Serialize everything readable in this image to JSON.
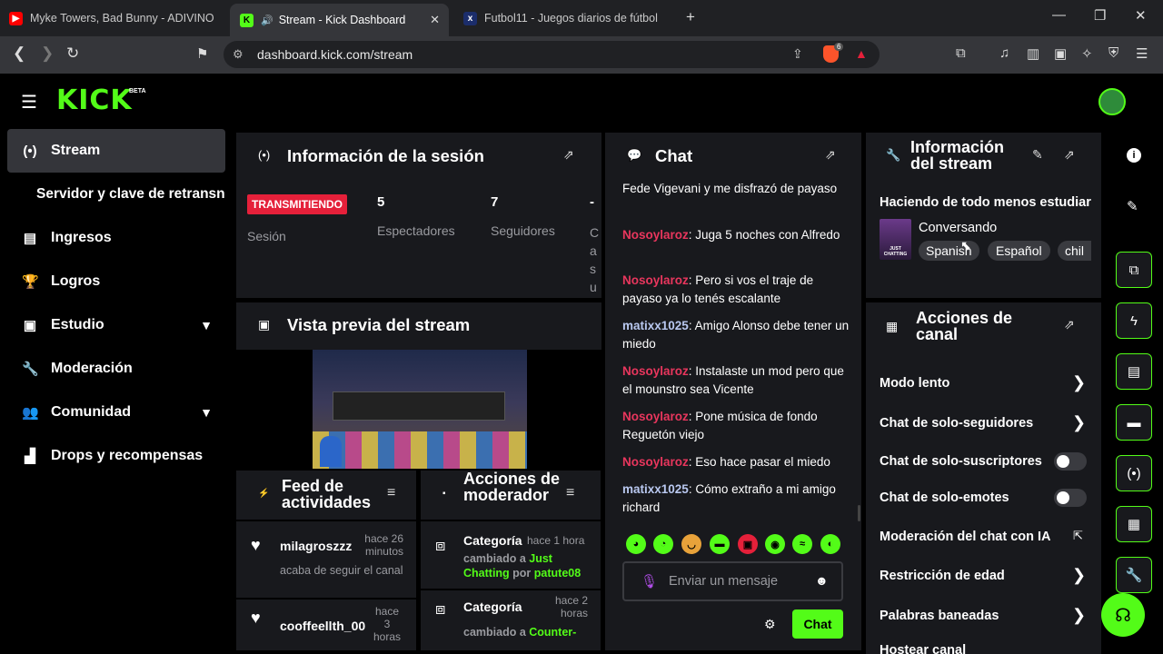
{
  "browser": {
    "tabs": [
      {
        "title": "Myke Towers, Bad Bunny - ADIVINO",
        "icon": "youtube-icon",
        "active": false
      },
      {
        "title": "Stream - Kick Dashboard",
        "icon": "kick-icon",
        "active": true
      },
      {
        "title": "Futbol11 - Juegos diarios de fútbol",
        "icon": "futbol11-icon",
        "active": false
      }
    ],
    "url": "dashboard.kick.com/stream",
    "shields_count": "6"
  },
  "app": {
    "logo": "KICK",
    "logo_badge": "BETA"
  },
  "sidebar": {
    "items": [
      {
        "label": "Stream",
        "icon": "stream-icon",
        "active": true
      },
      {
        "label": "Servidor y clave de retransn",
        "icon": "",
        "sub": true
      },
      {
        "label": "Ingresos",
        "icon": "chart-icon"
      },
      {
        "label": "Logros",
        "icon": "trophy-icon"
      },
      {
        "label": "Estudio",
        "icon": "studio-icon",
        "chevron": true
      },
      {
        "label": "Moderación",
        "icon": "wrench-icon"
      },
      {
        "label": "Comunidad",
        "icon": "community-icon",
        "chevron": true
      },
      {
        "label": "Drops y recompensas",
        "icon": "drops-icon"
      }
    ]
  },
  "session": {
    "title": "Información de la sesión",
    "live_badge": "TRANSMITIENDO",
    "live_label": "Sesión",
    "stats": [
      {
        "value": "5",
        "label": "Espectadores"
      },
      {
        "value": "7",
        "label": "Seguidores"
      },
      {
        "value": "-",
        "label": "Ca su"
      }
    ]
  },
  "preview": {
    "title": "Vista previa del stream"
  },
  "feed": {
    "title": "Feed de actividades",
    "items": [
      {
        "user": "milagroszzz",
        "time": "hace 26 minutos",
        "action": "acaba de seguir el canal"
      },
      {
        "user": "cooffeellth_00",
        "time": "hace 3 horas",
        "action": ""
      }
    ]
  },
  "modactions": {
    "title": "Acciones de moderador",
    "items": [
      {
        "title": "Categoría",
        "time": "hace 1 hora",
        "detail_prefix": "cambiado a ",
        "detail_value": "Just Chatting",
        "detail_mid": " por ",
        "detail_user": "patute08"
      },
      {
        "title": "Categoría",
        "time": "hace 2 horas",
        "detail_prefix": "cambiado a ",
        "detail_value": "Counter-",
        "detail_mid": "",
        "detail_user": ""
      }
    ]
  },
  "chat": {
    "title": "Chat",
    "messages": [
      {
        "user": "",
        "color": "#ffffff",
        "text": "Fede Vigevani y me disfrazó de payaso"
      },
      {
        "user": "Nosoylaroz",
        "color": "#e8365d",
        "text": ": Juga 5 noches con Alfredo"
      },
      {
        "user": "Nosoylaroz",
        "color": "#e8365d",
        "text": ": Pero si vos el traje de payaso ya lo tenés escalante"
      },
      {
        "user": "matixx1025",
        "color": "#b9c8f0",
        "text": ": Amigo Alonso debe tener un miedo"
      },
      {
        "user": "Nosoylaroz",
        "color": "#e8365d",
        "text": ": Instalaste un mod pero que el mounstro sea Vicente"
      },
      {
        "user": "Nosoylaroz",
        "color": "#e8365d",
        "text": ": Pone música de fondo Reguetón viejo"
      },
      {
        "user": "Nosoylaroz",
        "color": "#e8365d",
        "text": ": Eso hace pasar el miedo"
      },
      {
        "user": "matixx1025",
        "color": "#b9c8f0",
        "text": ": Cómo extraño a mi amigo richard"
      }
    ],
    "input_placeholder": "Enviar un mensaje",
    "send_label": "Chat"
  },
  "streaminfo": {
    "title": "Información del stream",
    "stream_title": "Haciendo de todo menos estudiar",
    "category": "Conversando",
    "thumb_text": "JUST CHATTING",
    "tags": [
      "Spanish",
      "Español",
      "chil"
    ]
  },
  "channel": {
    "title": "Acciones de canal",
    "rows": [
      {
        "label": "Modo lento",
        "control": "arrow"
      },
      {
        "label": "Chat de solo-seguidores",
        "control": "arrow"
      },
      {
        "label": "Chat de solo-suscriptores",
        "control": "toggle"
      },
      {
        "label": "Chat de solo-emotes",
        "control": "toggle"
      },
      {
        "label": "Moderación del chat con IA",
        "control": "external"
      },
      {
        "label": "Restricción de edad",
        "control": "arrow"
      },
      {
        "label": "Palabras baneadas",
        "control": "arrow"
      },
      {
        "label": "Hostear canal",
        "control": "arrow"
      }
    ]
  },
  "colors": {
    "accent": "#53fc18",
    "live": "#e5203a",
    "panel": "#18191d"
  }
}
